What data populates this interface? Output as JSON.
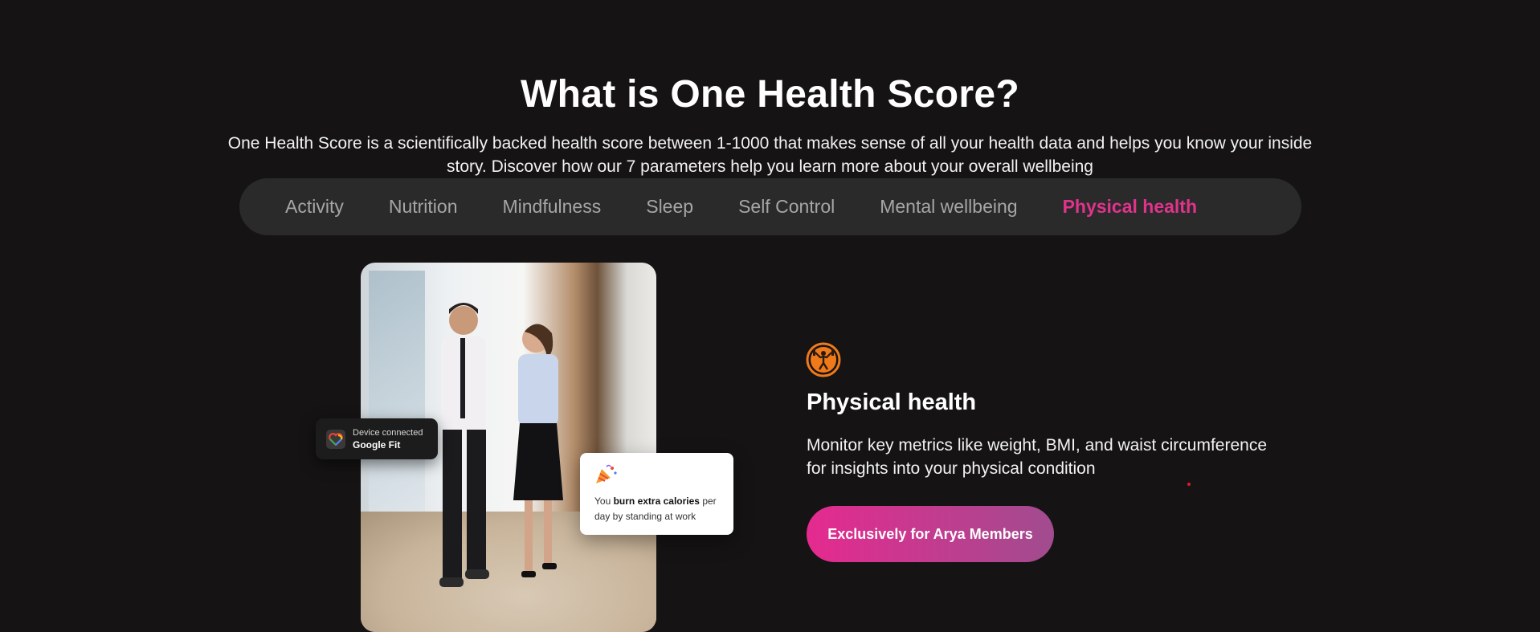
{
  "section": {
    "title": "What is One Health Score?",
    "description": "One Health Score is a scientifically backed health score between 1-1000 that makes sense of all your health data and helps you know your inside story. Discover how our 7 parameters help you learn more about your overall wellbeing"
  },
  "tabs": [
    {
      "label": "Activity",
      "active": false
    },
    {
      "label": "Nutrition",
      "active": false
    },
    {
      "label": "Mindfulness",
      "active": false
    },
    {
      "label": "Sleep",
      "active": false
    },
    {
      "label": "Self Control",
      "active": false
    },
    {
      "label": "Mental wellbeing",
      "active": false
    },
    {
      "label": "Physical health",
      "active": true
    }
  ],
  "device_badge": {
    "line1": "Device connected",
    "line2": "Google Fit",
    "icon": "google-fit-icon"
  },
  "calorie_card": {
    "icon": "party-popper-icon",
    "prefix": "You ",
    "bold": "burn extra calories",
    "suffix": " per day by standing at work"
  },
  "detail": {
    "icon": "weightlifter-icon",
    "title": "Physical health",
    "description": "Monitor key metrics like weight, BMI, and waist circumference for insights into your physical condition",
    "cta_label": "Exclusively for Arya Members"
  },
  "colors": {
    "background": "#151313",
    "accent": "#e0338c",
    "cta_start": "#e52a8f",
    "cta_end": "#a14c8f",
    "icon_orange": "#f07a1a"
  }
}
